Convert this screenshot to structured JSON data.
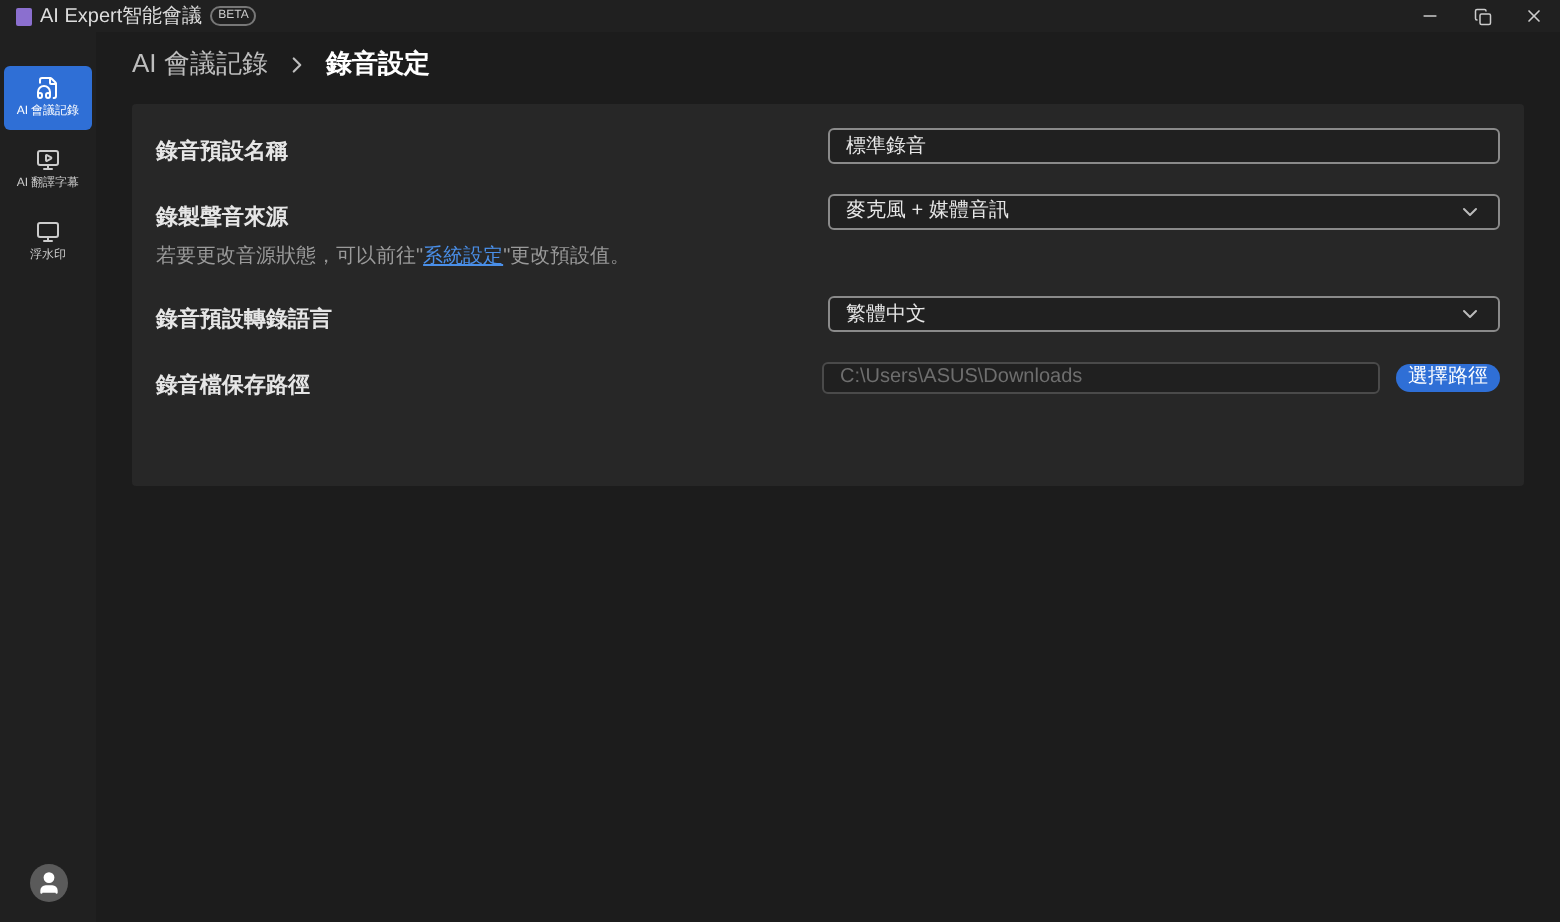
{
  "window": {
    "title": "AI Expert智能會議",
    "badge": "BETA"
  },
  "sidebar": {
    "items": [
      {
        "label": "AI 會議記錄",
        "selected": true
      },
      {
        "label": "AI 翻譯字幕",
        "selected": false
      },
      {
        "label": "浮水印",
        "selected": false
      }
    ]
  },
  "breadcrumb": [
    "AI 會議記錄",
    "錄音設定"
  ],
  "settings": [
    {
      "kind": "text",
      "label": "錄音預設名稱",
      "value": "標準錄音"
    },
    {
      "kind": "select",
      "label": "錄製聲音來源",
      "hint": {
        "before": "若要更改音源狀態，可以前往\"",
        "link": "系統設定",
        "after": "\"更改預設值。"
      },
      "value": "麥克風 + 媒體音訊"
    },
    {
      "kind": "select",
      "label": "錄音預設轉錄語言",
      "value": "繁體中文"
    },
    {
      "kind": "path",
      "label": "錄音檔保存路徑",
      "value": "C:\\Users\\ASUS\\Downloads",
      "disabled": true,
      "button": "選擇路徑"
    }
  ]
}
